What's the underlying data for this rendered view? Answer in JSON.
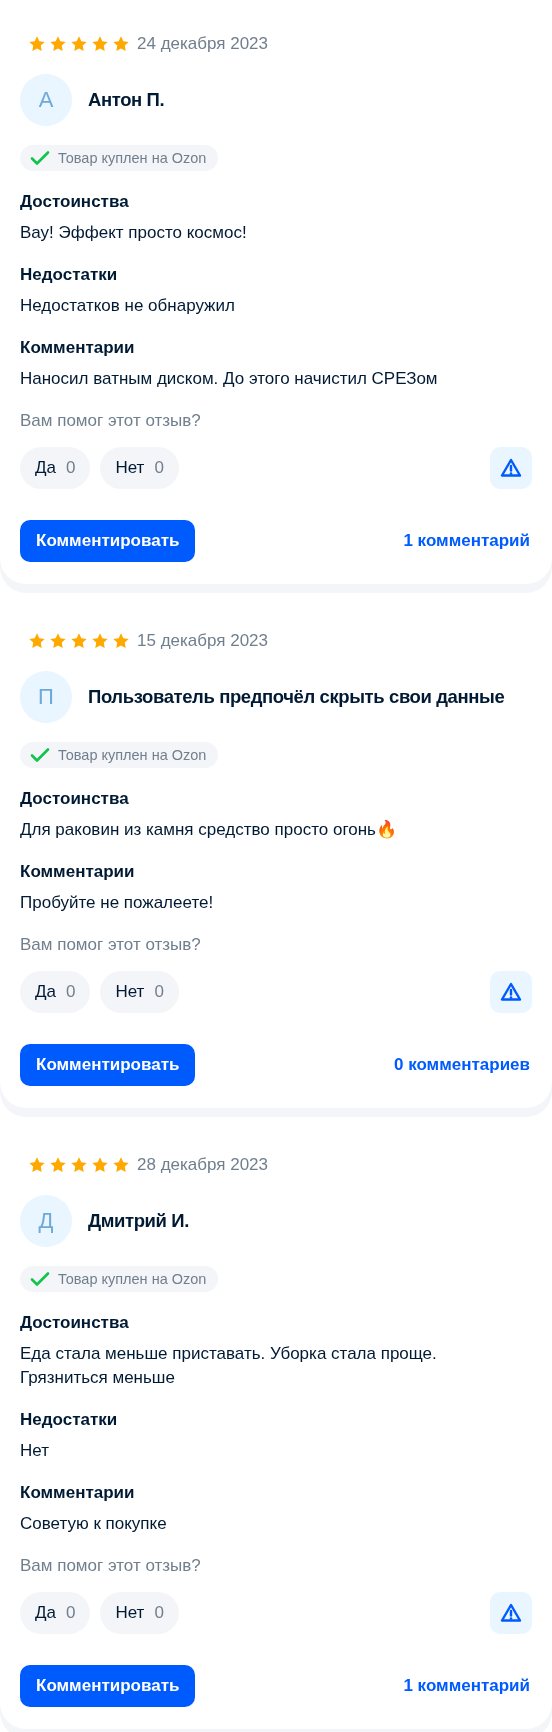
{
  "reviews": [
    {
      "stars": 5,
      "date": "24 декабря 2023",
      "avatar_letter": "А",
      "author": "Антон П.",
      "badge": "Товар куплен на Ozon",
      "sections": [
        {
          "title": "Достоинства",
          "text": "Вау! Эффект просто космос!"
        },
        {
          "title": "Недостатки",
          "text": "Недостатков не обнаружил"
        },
        {
          "title": "Комментарии",
          "text": "Наносил ватным диском. До этого начистил СРЕЗом"
        }
      ],
      "helpful_question": "Вам помог этот отзыв?",
      "yes_label": "Да",
      "yes_count": "0",
      "no_label": "Нет",
      "no_count": "0",
      "comment_button": "Комментировать",
      "comments_link": "1 комментарий"
    },
    {
      "stars": 5,
      "date": "15 декабря 2023",
      "avatar_letter": "П",
      "author": "Пользователь предпочёл скрыть свои данные",
      "badge": "Товар куплен на Ozon",
      "sections": [
        {
          "title": "Достоинства",
          "text": "Для раковин из камня средство просто огонь🔥"
        },
        {
          "title": "Комментарии",
          "text": "Пробуйте не пожалеете!"
        }
      ],
      "helpful_question": "Вам помог этот отзыв?",
      "yes_label": "Да",
      "yes_count": "0",
      "no_label": "Нет",
      "no_count": "0",
      "comment_button": "Комментировать",
      "comments_link": "0 комментариев"
    },
    {
      "stars": 5,
      "date": "28 декабря 2023",
      "avatar_letter": "Д",
      "author": "Дмитрий И.",
      "badge": "Товар куплен на Ozon",
      "sections": [
        {
          "title": "Достоинства",
          "text": "Еда стала меньше приставать. Уборка стала проще. Грязниться меньше"
        },
        {
          "title": "Недостатки",
          "text": "Нет"
        },
        {
          "title": "Комментарии",
          "text": "Советую к покупке"
        }
      ],
      "helpful_question": "Вам помог этот отзыв?",
      "yes_label": "Да",
      "yes_count": "0",
      "no_label": "Нет",
      "no_count": "0",
      "comment_button": "Комментировать",
      "comments_link": "1 комментарий"
    }
  ]
}
